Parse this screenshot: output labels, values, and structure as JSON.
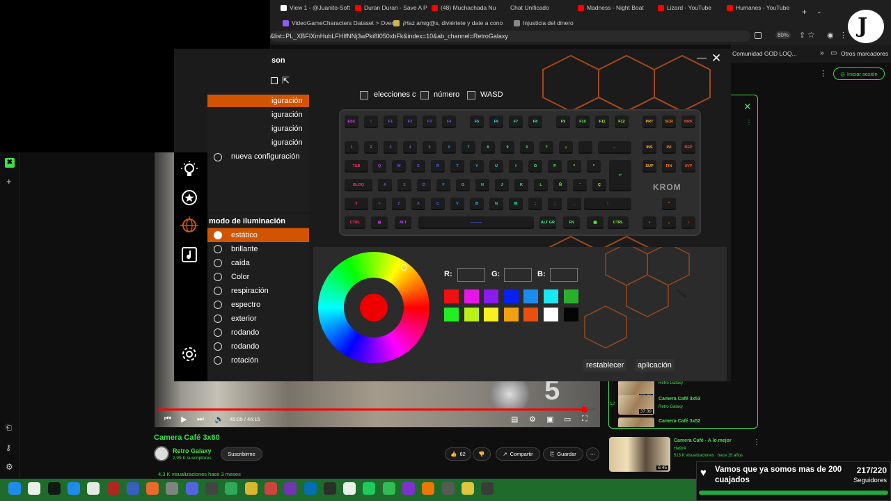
{
  "browser": {
    "tabs": [
      {
        "label": "View 1 - @Juanito-Soft",
        "color": "#ffffff"
      },
      {
        "label": "Duran Duran - Save A Pr",
        "color": "#ff0000"
      },
      {
        "label": "(48) Muchachada Nu",
        "color": "#ff0000"
      },
      {
        "label": "Chat Unificado",
        "color": "#1f1f1f"
      },
      {
        "label": "Madness - Night Boat",
        "color": "#ff0000"
      },
      {
        "label": "Lizard - YouTube",
        "color": "#ff0000"
      },
      {
        "label": "Humanes - YouTube",
        "color": "#ff0000"
      }
    ],
    "bookmarks": [
      {
        "label": "VideoGameCharacters Dataset > Over",
        "color": "#8b5cf6"
      },
      {
        "label": "¡Haz amig@s, diviértete y date a cono",
        "color": "#d4b44a"
      },
      {
        "label": "Injusticia del dinero",
        "color": "#888888"
      }
    ],
    "url": "&list=PL_XBFIXmHubLFHIfNNj3wPki8I050xbFk&index=10&ab_channel=RetroGalaxy",
    "zoom": "80%",
    "bookmark_right_1": "Comunidad GOD LOQ...",
    "bookmark_right_2": "Otros marcadores"
  },
  "youtube": {
    "signin": "Iniciar sesión",
    "video_title": "Camera Café 3x60",
    "channel": "Retro Galaxy",
    "subscribers": "2,99 K suscriptores",
    "subscribe": "Suscribirme",
    "likes": "62",
    "share": "Compartir",
    "save": "Guardar",
    "views": "4,3 K visualizaciones  hace 3 meses",
    "time": "45:05 / 46:15",
    "progress": 0.975,
    "playlist": [
      {
        "title": "",
        "channel": "Retro Galaxy",
        "duration": "31:06",
        "num": ""
      },
      {
        "title": "Camera Café 3x53",
        "channel": "Retro Galaxy",
        "duration": "37:09",
        "num": "12"
      },
      {
        "title": "Camera Café 3x52",
        "channel": "",
        "duration": "",
        "num": ""
      }
    ],
    "recommended": {
      "title": "Camera Café - A lo mejor",
      "channel": "Ha9z4",
      "meta": "513 K visualizaciones · hace 15 años",
      "duration": "6:45"
    }
  },
  "app": {
    "title": "son",
    "configs": [
      {
        "label": "iguración",
        "selected": true
      },
      {
        "label": "iguración",
        "selected": false
      },
      {
        "label": "iguración",
        "selected": false
      },
      {
        "label": "iguración",
        "selected": false
      },
      {
        "label": "nueva configuración",
        "selected": false
      }
    ],
    "mode_header": "modo de iluminación",
    "modes": [
      {
        "label": "estático",
        "selected": true
      },
      {
        "label": "brillante",
        "selected": false
      },
      {
        "label": "caída",
        "selected": false
      },
      {
        "label": "Color",
        "selected": false
      },
      {
        "label": "respiración",
        "selected": false
      },
      {
        "label": "espectro",
        "selected": false
      },
      {
        "label": "exterior",
        "selected": false
      },
      {
        "label": "rodando",
        "selected": false
      },
      {
        "label": "rodando",
        "selected": false
      },
      {
        "label": "rotación",
        "selected": false
      }
    ],
    "checkboxes": [
      "elecciones c",
      "número",
      "WASD"
    ],
    "brand": "KROM",
    "rgb_labels": [
      "R:",
      "G:",
      "B:"
    ],
    "swatches": [
      "#ee1111",
      "#e815e8",
      "#8a1aee",
      "#0a20f0",
      "#1a8cf0",
      "#18e8f0",
      "#28b02c",
      "#22ee22",
      "#b8f018",
      "#f8f020",
      "#f0a010",
      "#e85010",
      "#ffffff",
      "#050505"
    ],
    "reset": "restablecer",
    "apply": "aplicación",
    "selected_color": "#ee0000"
  },
  "notification": {
    "message": "Vamos que ya somos mas de 200 cuajados",
    "count": "217/220",
    "label": "Seguidores"
  }
}
